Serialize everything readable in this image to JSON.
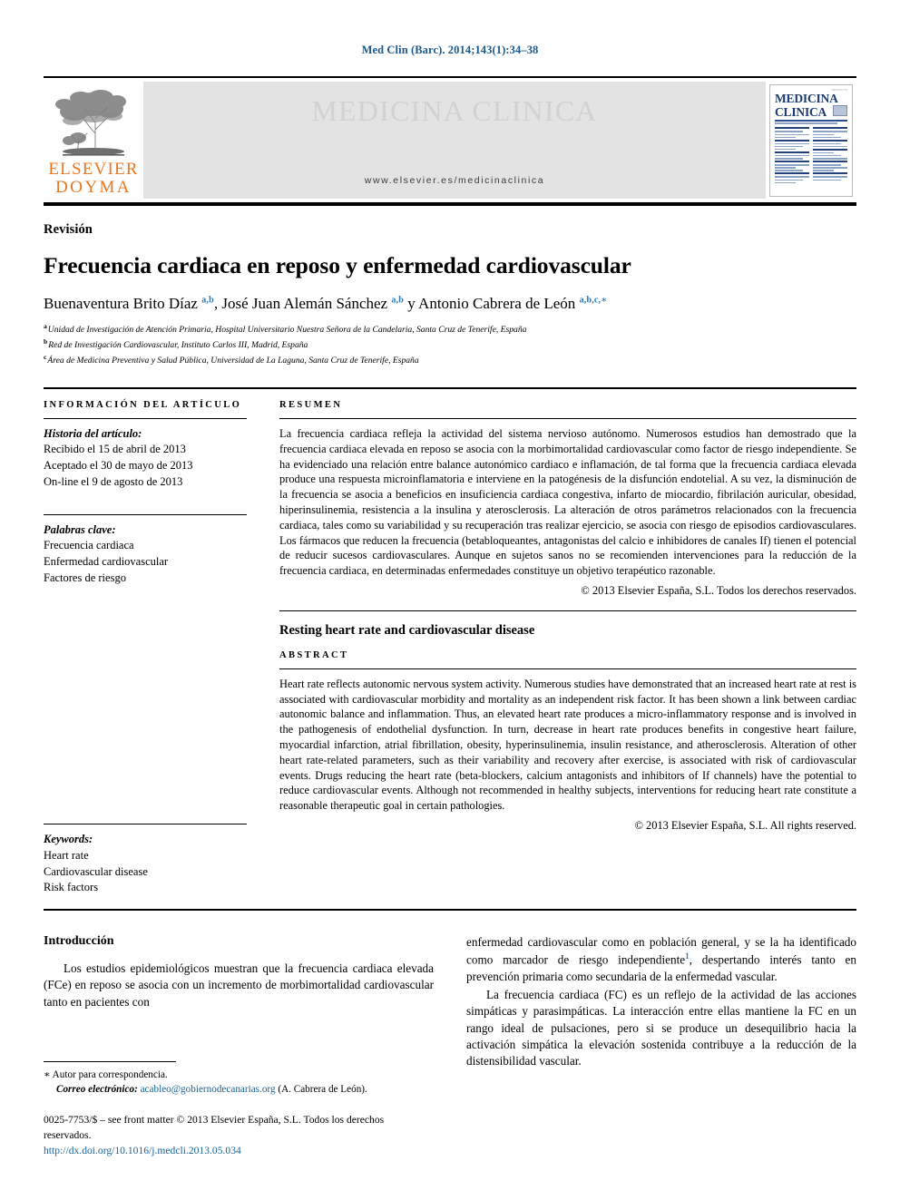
{
  "running_head": "Med Clin (Barc). 2014;143(1):34–38",
  "masthead": {
    "publisher_line1": "ELSEVIER",
    "publisher_line2": "DOYMA",
    "journal_title": "MEDICINA CLINICA",
    "journal_url": "www.elsevier.es/medicinaclinica",
    "cover_title_line1": "MEDICINA",
    "cover_title_line2": "CLINICA"
  },
  "article": {
    "kind": "Revisión",
    "title": "Frecuencia cardiaca en reposo y enfermedad cardiovascular",
    "authors_html": "Buenaventura Brito Díaz <sup>a,b</sup>, José Juan Alemán Sánchez <sup>a,b</sup> y Antonio Cabrera de León <sup>a,b,c,∗</sup>",
    "affiliations": [
      {
        "mark": "a",
        "text": "Unidad de Investigación de Atención Primaria, Hospital Universitario Nuestra Señora de la Candelaria, Santa Cruz de Tenerife, España"
      },
      {
        "mark": "b",
        "text": "Red de Investigación Cardiovascular, Instituto Carlos III, Madrid, España"
      },
      {
        "mark": "c",
        "text": "Área de Medicina Preventiva y Salud Pública, Universidad de La Laguna, Santa Cruz de Tenerife, España"
      }
    ]
  },
  "info": {
    "heading": "INFORMACIÓN DEL ARTÍCULO",
    "history_label": "Historia del artículo:",
    "history": [
      "Recibido el 15 de abril de 2013",
      "Aceptado el 30 de mayo de 2013",
      "On-line el 9 de agosto de 2013"
    ],
    "keywords_es_label": "Palabras clave:",
    "keywords_es": [
      "Frecuencia cardiaca",
      "Enfermedad cardiovascular",
      "Factores de riesgo"
    ],
    "keywords_en_label": "Keywords:",
    "keywords_en": [
      "Heart rate",
      "Cardiovascular disease",
      "Risk factors"
    ]
  },
  "abstract_es": {
    "heading": "RESUMEN",
    "text": "La frecuencia cardiaca refleja la actividad del sistema nervioso autónomo. Numerosos estudios han demostrado que la frecuencia cardiaca elevada en reposo se asocia con la morbimortalidad cardiovascular como factor de riesgo independiente. Se ha evidenciado una relación entre balance autonómico cardiaco e inflamación, de tal forma que la frecuencia cardiaca elevada produce una respuesta microinflamatoria e interviene en la patogénesis de la disfunción endotelial. A su vez, la disminución de la frecuencia se asocia a beneficios en insuficiencia cardiaca congestiva, infarto de miocardio, fibrilación auricular, obesidad, hiperinsulinemia, resistencia a la insulina y aterosclerosis. La alteración de otros parámetros relacionados con la frecuencia cardiaca, tales como su variabilidad y su recuperación tras realizar ejercicio, se asocia con riesgo de episodios cardiovasculares. Los fármacos que reducen la frecuencia (betabloqueantes, antagonistas del calcio e inhibidores de canales If) tienen el potencial de reducir sucesos cardiovasculares. Aunque en sujetos sanos no se recomienden intervenciones para la reducción de la frecuencia cardiaca, en determinadas enfermedades constituye un objetivo terapéutico razonable.",
    "copyright": "© 2013 Elsevier España, S.L. Todos los derechos reservados."
  },
  "abstract_en": {
    "title": "Resting heart rate and cardiovascular disease",
    "heading": "ABSTRACT",
    "text": "Heart rate reflects autonomic nervous system activity. Numerous studies have demonstrated that an increased heart rate at rest is associated with cardiovascular morbidity and mortality as an independent risk factor. It has been shown a link between cardiac autonomic balance and inflammation. Thus, an elevated heart rate produces a micro-inflammatory response and is involved in the pathogenesis of endothelial dysfunction. In turn, decrease in heart rate produces benefits in congestive heart failure, myocardial infarction, atrial fibrillation, obesity, hyperinsulinemia, insulin resistance, and atherosclerosis. Alteration of other heart rate-related parameters, such as their variability and recovery after exercise, is associated with risk of cardiovascular events. Drugs reducing the heart rate (beta-blockers, calcium antagonists and inhibitors of If channels) have the potential to reduce cardiovascular events. Although not recommended in healthy subjects, interventions for reducing heart rate constitute a reasonable therapeutic goal in certain pathologies.",
    "copyright": "© 2013 Elsevier España, S.L. All rights reserved."
  },
  "body": {
    "section_heading": "Introducción",
    "left_paragraph": "Los estudios epidemiológicos muestran que la frecuencia cardiaca elevada (FCe) en reposo se asocia con un incremento de morbimortalidad cardiovascular tanto en pacientes con",
    "right_paragraph_1_before": "enfermedad cardiovascular como en población general, y se la ha identificado como marcador de riesgo independiente",
    "right_paragraph_1_ref": "1",
    "right_paragraph_1_after": ", despertando interés tanto en prevención primaria como secundaria de la enfermedad vascular.",
    "right_paragraph_2": "La frecuencia cardiaca (FC) es un reflejo de la actividad de las acciones simpáticas y parasimpáticas. La interacción entre ellas mantiene la FC en un rango ideal de pulsaciones, pero si se produce un desequilibrio hacia la activación simpática la elevación sostenida contribuye a la reducción de la distensibilidad vascular."
  },
  "footnotes": {
    "corresponding_marker": "∗",
    "corresponding_text": "Autor para correspondencia.",
    "email_label": "Correo electrónico:",
    "email": "acableo@gobiernodecanarias.org",
    "email_owner": "(A. Cabrera de León).",
    "issn_line": "0025-7753/$ – see front matter © 2013 Elsevier España, S.L. Todos los derechos reservados.",
    "doi": "http://dx.doi.org/10.1016/j.medcli.2013.05.034"
  },
  "colors": {
    "link_blue": "#1a6496",
    "ref_blue": "#2b7bb9",
    "elsevier_orange": "#E87722",
    "cover_blue": "#1b3a73"
  }
}
